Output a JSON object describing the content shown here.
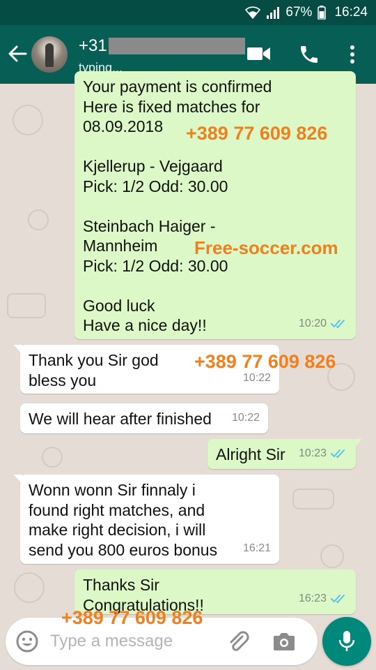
{
  "status_bar": {
    "battery": "67%",
    "time": "16:24"
  },
  "header": {
    "contact_prefix": "+31",
    "status": "typing..."
  },
  "messages": [
    {
      "dir": "out",
      "text": "Your payment is confirmed\nHere is fixed matches for\n08.09.2018\n\nKjellerup - Vejgaard\nPick: 1/2 Odd: 30.00\n\nSteinbach Haiger -\nMannheim\nPick: 1/2  Odd: 30.00\n\nGood luck\nHave a nice day!!",
      "time": "10:20",
      "status": "read"
    },
    {
      "dir": "in",
      "text": "Thank you Sir god\nbless you",
      "time": "10:22"
    },
    {
      "dir": "in",
      "text": "We will hear after finished",
      "time": "10:22"
    },
    {
      "dir": "out",
      "text": "Alright Sir",
      "time": "10:23",
      "status": "read"
    },
    {
      "dir": "in",
      "text": "Wonn wonn Sir finnaly i\nfound right matches, and\nmake right decision, i will\nsend you 800 euros bonus",
      "time": "16:21"
    },
    {
      "dir": "out",
      "text": "Thanks Sir\nCongratulations!!",
      "time": "16:23",
      "status": "read"
    }
  ],
  "watermarks": {
    "phone_1": "+389 77 609 826",
    "site": "Free-soccer.com",
    "phone_2": "+389 77 609 826",
    "phone_3": "+389 77 609 826"
  },
  "input": {
    "placeholder": "Type a message"
  },
  "colors": {
    "header": "#075e54",
    "status_bar": "#054d44",
    "outgoing_bubble": "#dcf8c6",
    "incoming_bubble": "#ffffff",
    "read_ticks": "#4fc3f7",
    "watermark": "#f07f1e",
    "mic_button": "#00897b"
  },
  "icons": {
    "back": "arrow-left-icon",
    "video": "video-camera-icon",
    "call": "phone-icon",
    "menu": "more-vertical-icon",
    "emoji": "emoji-icon",
    "attach": "paperclip-icon",
    "camera": "camera-icon",
    "mic": "microphone-icon",
    "ticks": "double-check-icon"
  }
}
